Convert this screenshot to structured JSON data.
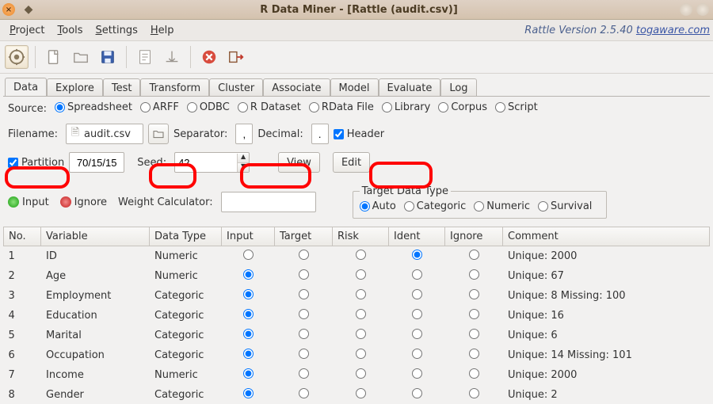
{
  "window": {
    "title": "R Data Miner - [Rattle (audit.csv)]"
  },
  "brand": {
    "text": "Rattle Version 2.5.40 ",
    "link": "togaware.com"
  },
  "menu": {
    "project": "Project",
    "tools": "Tools",
    "settings": "Settings",
    "help": "Help"
  },
  "tabs": [
    "Data",
    "Explore",
    "Test",
    "Transform",
    "Cluster",
    "Associate",
    "Model",
    "Evaluate",
    "Log"
  ],
  "activeTab": 0,
  "source": {
    "label": "Source:",
    "options": [
      "Spreadsheet",
      "ARFF",
      "ODBC",
      "R Dataset",
      "RData File",
      "Library",
      "Corpus",
      "Script"
    ],
    "selected": 0
  },
  "filerow": {
    "label": "Filename:",
    "filename": "audit.csv",
    "sep_label": "Separator:",
    "sep_value": ",",
    "dec_label": "Decimal:",
    "dec_value": ".",
    "header_label": "Header"
  },
  "partrow": {
    "partition_label": "Partition",
    "partition_value": "70/15/15",
    "seed_label": "Seed:",
    "seed_value": "42",
    "view": "View",
    "edit": "Edit"
  },
  "rolerow": {
    "input": "Input",
    "ignore": "Ignore",
    "weight_label": "Weight Calculator:",
    "weight_value": "",
    "tdt_legend": "Target Data Type",
    "tdt_options": [
      "Auto",
      "Categoric",
      "Numeric",
      "Survival"
    ],
    "tdt_selected": 0
  },
  "table": {
    "headers": [
      "No.",
      "Variable",
      "Data Type",
      "Input",
      "Target",
      "Risk",
      "Ident",
      "Ignore",
      "Comment"
    ],
    "rows": [
      {
        "no": "1",
        "var": "ID",
        "dtype": "Numeric",
        "role": "Ident",
        "comment": "Unique: 2000"
      },
      {
        "no": "2",
        "var": "Age",
        "dtype": "Numeric",
        "role": "Input",
        "comment": "Unique: 67"
      },
      {
        "no": "3",
        "var": "Employment",
        "dtype": "Categoric",
        "role": "Input",
        "comment": "Unique: 8 Missing: 100"
      },
      {
        "no": "4",
        "var": "Education",
        "dtype": "Categoric",
        "role": "Input",
        "comment": "Unique: 16"
      },
      {
        "no": "5",
        "var": "Marital",
        "dtype": "Categoric",
        "role": "Input",
        "comment": "Unique: 6"
      },
      {
        "no": "6",
        "var": "Occupation",
        "dtype": "Categoric",
        "role": "Input",
        "comment": "Unique: 14 Missing: 101"
      },
      {
        "no": "7",
        "var": "Income",
        "dtype": "Numeric",
        "role": "Input",
        "comment": "Unique: 2000"
      },
      {
        "no": "8",
        "var": "Gender",
        "dtype": "Categoric",
        "role": "Input",
        "comment": "Unique: 2"
      }
    ]
  }
}
